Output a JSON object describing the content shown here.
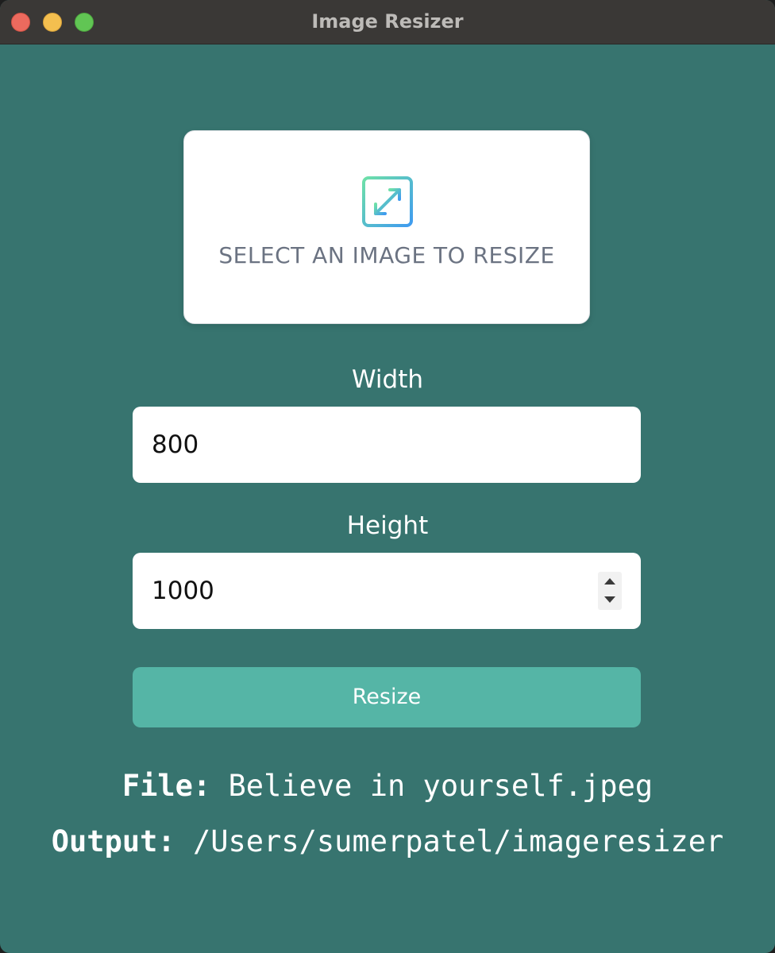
{
  "window": {
    "title": "Image Resizer"
  },
  "select_card": {
    "label": "SELECT AN IMAGE TO RESIZE",
    "icon": "resize-icon"
  },
  "width_field": {
    "label": "Width",
    "value": "800"
  },
  "height_field": {
    "label": "Height",
    "value": "1000"
  },
  "resize_button": {
    "label": "Resize"
  },
  "info": {
    "file_label": "File:",
    "file_value": "Believe in yourself.jpeg",
    "output_label": "Output:",
    "output_value": "/Users/sumerpatel/imageresizer"
  },
  "colors": {
    "background": "#37746f",
    "titlebar": "#3a3836",
    "button": "#55b5a6",
    "icon_gradient_start": "#6ee0a8",
    "icon_gradient_end": "#3f9bf0"
  }
}
